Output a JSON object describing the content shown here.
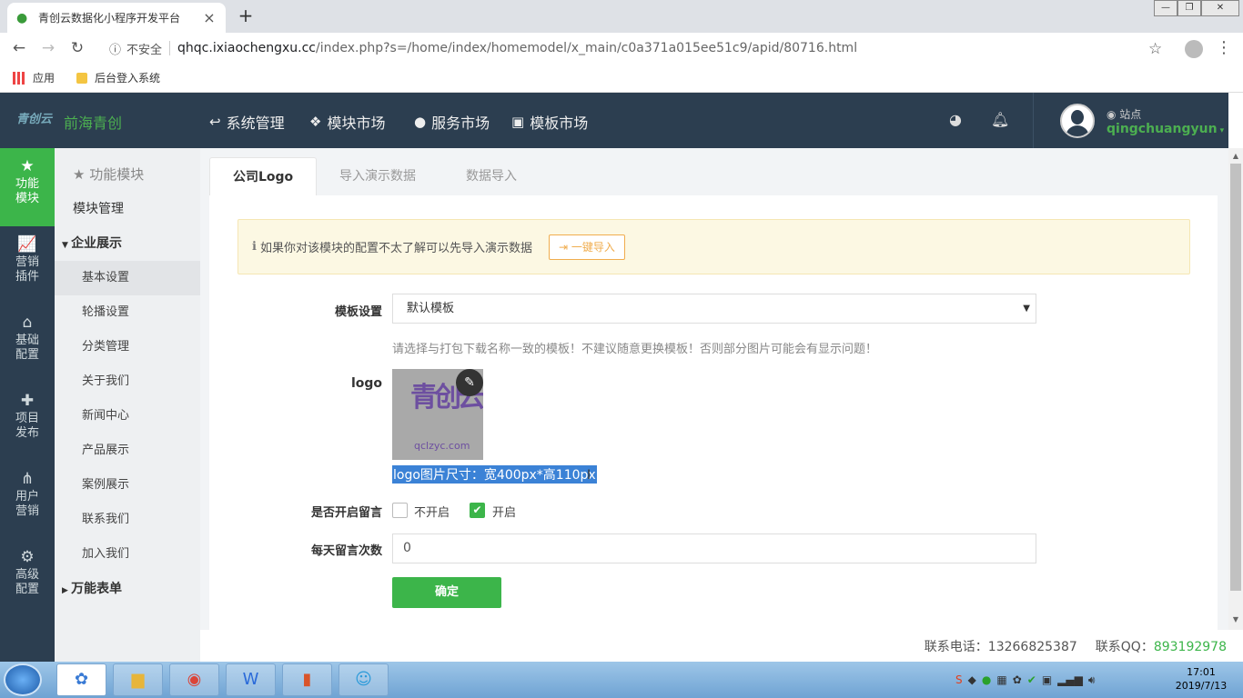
{
  "browser": {
    "tab_title": "青创云数据化小程序开发平台",
    "tab_close": "×",
    "new_tab": "+",
    "back": "←",
    "forward": "→",
    "reload": "↻",
    "security_label": "不安全",
    "url_host": "qhqc.ixiaochengxu.cc",
    "url_path": "/index.php?s=/home/index/homemodel/x_main/c0a371a015ee51c9/apid/80716.html",
    "bookmarks": [
      "应用",
      "后台登入系统"
    ]
  },
  "header": {
    "logo_text": "青创云",
    "brand": "前海青创",
    "nav": [
      "系统管理",
      "模块市场",
      "服务市场",
      "模板市场"
    ],
    "site_label": "站点",
    "username": "qingchuangyun"
  },
  "rail": [
    {
      "label": "功能\n模块",
      "icon": "star-icon",
      "glyph": "★",
      "active": true
    },
    {
      "label": "营销\n插件",
      "icon": "chart-icon",
      "glyph": "📈",
      "active": false
    },
    {
      "label": "基础\n配置",
      "icon": "home-icon",
      "glyph": "⌂",
      "active": false
    },
    {
      "label": "项目\n发布",
      "icon": "puzzle-icon",
      "glyph": "✚",
      "active": false
    },
    {
      "label": "用户\n营销",
      "icon": "sitemap-icon",
      "glyph": "⋔",
      "active": false
    },
    {
      "label": "高级\n配置",
      "icon": "gear-icon",
      "glyph": "⚙",
      "active": false
    }
  ],
  "sidebar": {
    "heading": "功能模块",
    "module_manage": "模块管理",
    "group1": "企业展示",
    "items": [
      "基本设置",
      "轮播设置",
      "分类管理",
      "关于我们",
      "新闻中心",
      "产品展示",
      "案例展示",
      "联系我们",
      "加入我们"
    ],
    "group2": "万能表单"
  },
  "tabs": [
    "公司Logo",
    "导入演示数据",
    "数据导入"
  ],
  "alert": {
    "text": "如果你对该模块的配置不太了解可以先导入演示数据",
    "button": "一键导入"
  },
  "form": {
    "template_label": "模板设置",
    "template_value": "默认模板",
    "template_help": "请选择与打包下载名称一致的模板！不建议随意更换模板！否则部分图片可能会有显示问题！",
    "logo_label": "logo",
    "logo_image_big": "青创云",
    "logo_image_small": "qclzyc.com",
    "logo_hint": "logo图片尺寸：宽400px*高110px",
    "message_label": "是否开启留言",
    "message_off": "不开启",
    "message_on": "开启",
    "message_enabled": true,
    "count_label": "每天留言次数",
    "count_value": "0",
    "submit": "确定"
  },
  "footer": {
    "phone": "联系电话：13266825387",
    "qq_label": "联系QQ：",
    "qq": "893192978"
  },
  "taskbar": {
    "time": "17:01",
    "date": "2019/7/13"
  }
}
